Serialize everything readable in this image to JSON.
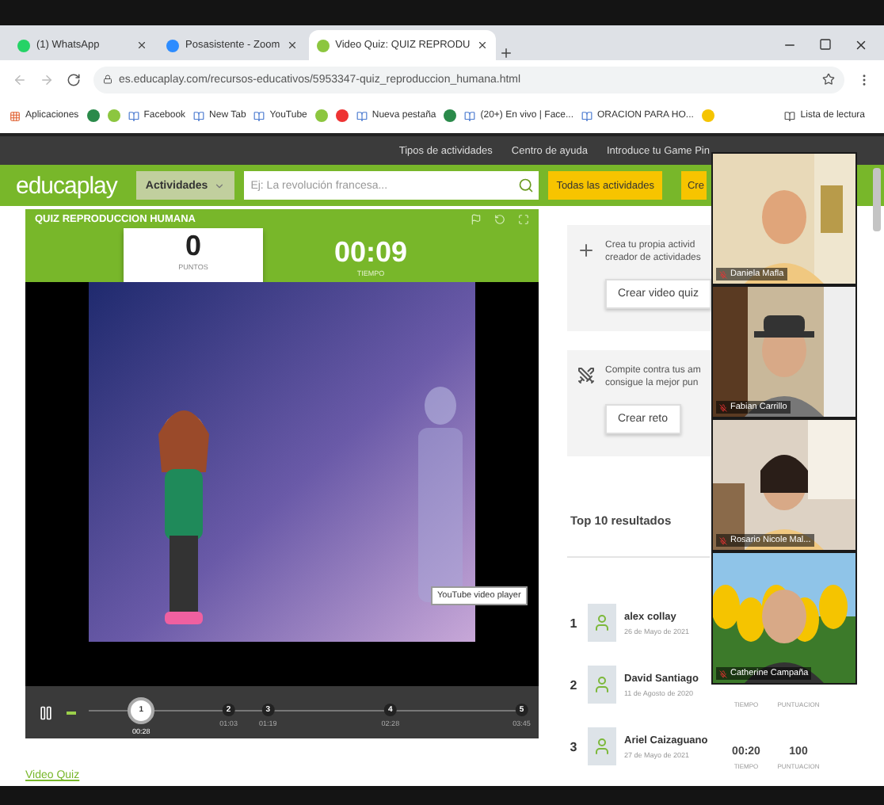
{
  "browser": {
    "tabs": [
      {
        "title": "(1) WhatsApp",
        "selected": false
      },
      {
        "title": "Posasistente - Zoom",
        "selected": false
      },
      {
        "title": "Video Quiz: QUIZ REPRODU",
        "selected": true
      }
    ],
    "url": "es.educaplay.com/recursos-educativos/5953347-quiz_reproduccion_humana.html",
    "bookmarks": [
      {
        "kind": "link",
        "label": "Aplicaciones"
      },
      {
        "kind": "icon"
      },
      {
        "kind": "icon"
      },
      {
        "kind": "link",
        "label": "Facebook"
      },
      {
        "kind": "link",
        "label": "New Tab"
      },
      {
        "kind": "link",
        "label": "YouTube"
      },
      {
        "kind": "icon"
      },
      {
        "kind": "icon"
      },
      {
        "kind": "link",
        "label": "Nueva pestaña"
      },
      {
        "kind": "icon"
      },
      {
        "kind": "link",
        "label": "(20+) En vivo | Face..."
      },
      {
        "kind": "link",
        "label": "ORACION PARA HO..."
      },
      {
        "kind": "icon"
      }
    ],
    "reading_list": "Lista de lectura"
  },
  "site": {
    "nav": [
      "Tipos de actividades",
      "Centro de ayuda",
      "Introduce tu Game Pin"
    ],
    "logo": "educaplay",
    "category": "Actividades",
    "search_placeholder": "Ej: La revolución francesa...",
    "all_button": "Todas las actividades",
    "create_button": "Cre"
  },
  "quiz": {
    "title": "QUIZ REPRODUCCION HUMANA",
    "score": "0",
    "score_label": "PUNTOS",
    "time": "00:09",
    "time_label": "TIEMPO",
    "tooltip": "YouTube video player",
    "markers": [
      {
        "number": "1",
        "time": "00:28",
        "selected": true
      },
      {
        "number": "2",
        "time": "01:03",
        "selected": false
      },
      {
        "number": "3",
        "time": "01:19",
        "selected": false
      },
      {
        "number": "4",
        "time": "02:28",
        "selected": false
      },
      {
        "number": "5",
        "time": "03:45",
        "selected": false
      }
    ],
    "footer_link": "Video Quiz"
  },
  "sidebar": {
    "cards": [
      {
        "kind": "create",
        "lines": [
          "Crea tu propia activid",
          "creador de actividades"
        ],
        "button": "Crear video quiz"
      },
      {
        "kind": "challenge",
        "lines": [
          "Compite contra tus am",
          "consigue la mejor pun"
        ],
        "button": "Crear reto"
      }
    ],
    "results_title": "Top 10 resultados",
    "results": [
      {
        "rank": "1",
        "name": "alex collay",
        "date": "26 de Mayo de 2021"
      },
      {
        "rank": "2",
        "name": "David Santiago",
        "date": "11 de Agosto de 2020",
        "time_label": "TIEMPO",
        "score_label": "PUNTUACION"
      },
      {
        "rank": "3",
        "name": "Ariel Caizaguano",
        "date": "27 de Mayo de 2021",
        "time": "00:20",
        "time_label": "TIEMPO",
        "score": "100",
        "score_label": "PUNTUACION"
      }
    ]
  },
  "meeting": {
    "participants": [
      {
        "name": "Daniela Mafla"
      },
      {
        "name": "Fabian Carrillo"
      },
      {
        "name": "Rosario Nicole Mal..."
      },
      {
        "name": "Catherine Campaña"
      }
    ]
  }
}
